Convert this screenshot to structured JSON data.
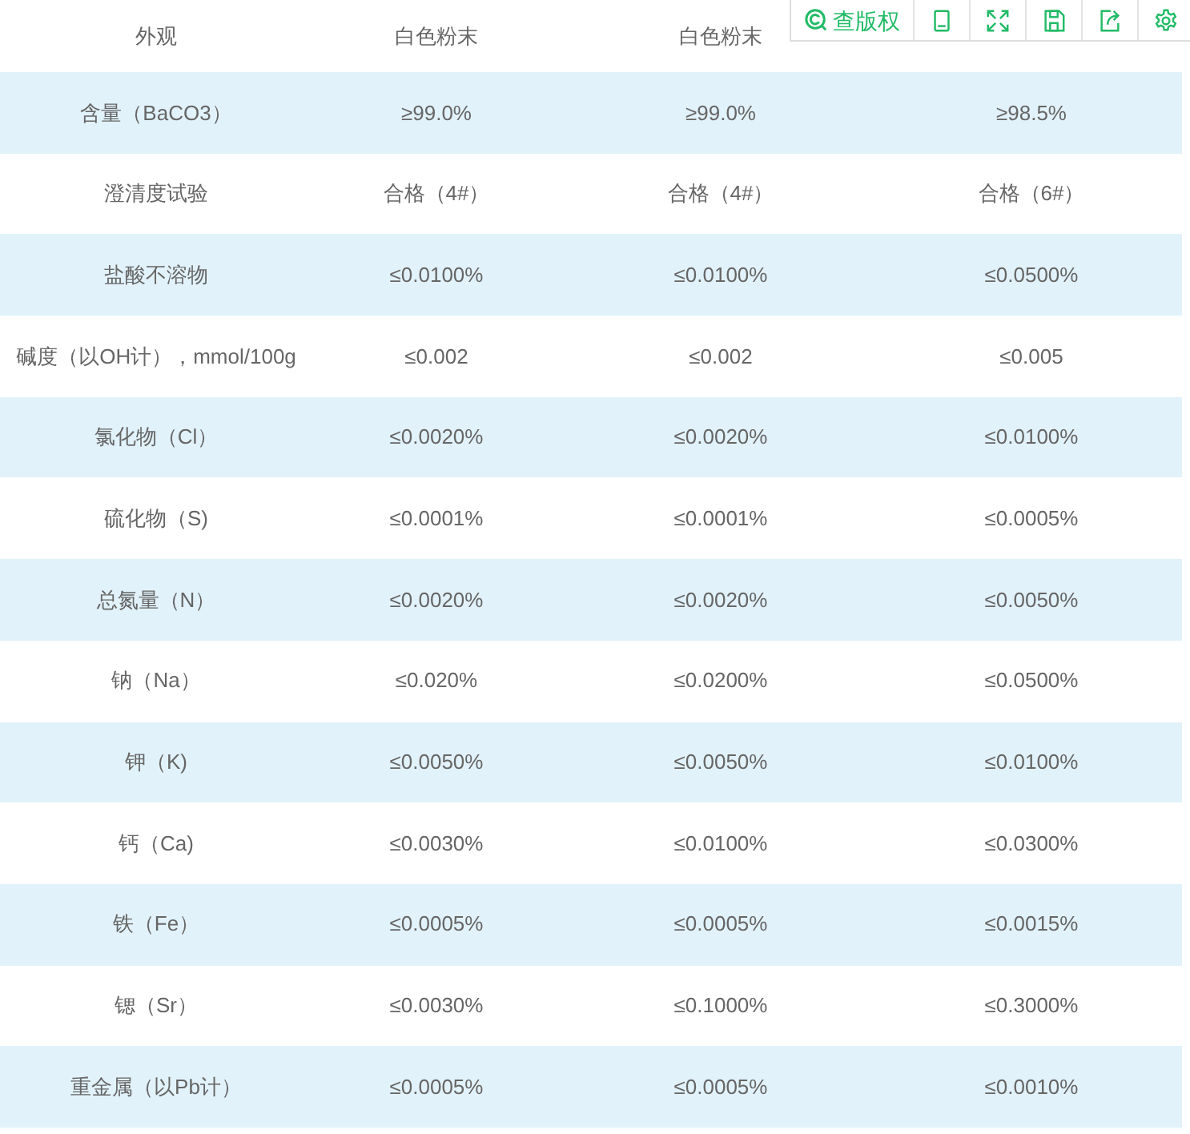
{
  "toolbar": {
    "copyright_button": "查版权"
  },
  "table": {
    "rows": [
      {
        "cells": [
          "外观",
          "白色粉末",
          "白色粉末"
        ]
      },
      {
        "cells": [
          "含量（BaCO3）",
          "≥99.0%",
          "≥99.0%",
          "≥98.5%"
        ]
      },
      {
        "cells": [
          "澄清度试验",
          "合格（4#）",
          "合格（4#）",
          "合格（6#）"
        ]
      },
      {
        "cells": [
          "盐酸不溶物",
          "≤0.0100%",
          "≤0.0100%",
          "≤0.0500%"
        ]
      },
      {
        "cells": [
          "碱度（以OH计），mmol/100g",
          "≤0.002",
          "≤0.002",
          "≤0.005"
        ]
      },
      {
        "cells": [
          "氯化物（Cl）",
          "≤0.0020%",
          "≤0.0020%",
          "≤0.0100%"
        ]
      },
      {
        "cells": [
          "硫化物（S)",
          "≤0.0001%",
          "≤0.0001%",
          "≤0.0005%"
        ]
      },
      {
        "cells": [
          "总氮量（N）",
          "≤0.0020%",
          "≤0.0020%",
          "≤0.0050%"
        ]
      },
      {
        "cells": [
          "钠（Na）",
          "≤0.020%",
          "≤0.0200%",
          "≤0.0500%"
        ]
      },
      {
        "cells": [
          "钾（K)",
          "≤0.0050%",
          "≤0.0050%",
          "≤0.0100%"
        ]
      },
      {
        "cells": [
          "钙（Ca)",
          "≤0.0030%",
          "≤0.0100%",
          "≤0.0300%"
        ]
      },
      {
        "cells": [
          "铁（Fe）",
          "≤0.0005%",
          "≤0.0005%",
          "≤0.0015%"
        ]
      },
      {
        "cells": [
          "锶（Sr）",
          "≤0.0030%",
          "≤0.1000%",
          "≤0.3000%"
        ]
      },
      {
        "cells": [
          "重金属（以Pb计）",
          "≤0.0005%",
          "≤0.0005%",
          "≤0.0010%"
        ]
      }
    ]
  }
}
